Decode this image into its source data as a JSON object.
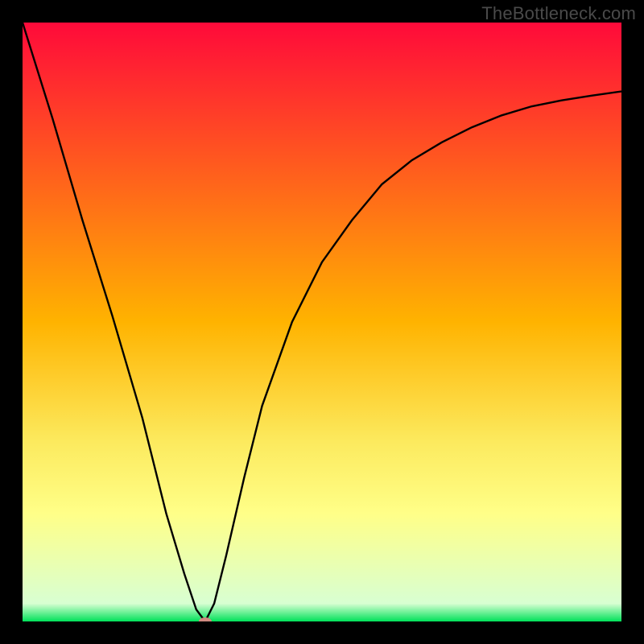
{
  "watermark": "TheBottleneck.com",
  "chart_data": {
    "type": "line",
    "title": "",
    "xlabel": "",
    "ylabel": "",
    "xlim": [
      0,
      100
    ],
    "ylim": [
      0,
      100
    ],
    "grid": false,
    "legend": false,
    "background_gradient": {
      "stops": [
        {
          "offset": 0.0,
          "color": "#ff0a3a"
        },
        {
          "offset": 0.5,
          "color": "#ffb300"
        },
        {
          "offset": 0.7,
          "color": "#fcea5e"
        },
        {
          "offset": 0.82,
          "color": "#ffff88"
        },
        {
          "offset": 0.97,
          "color": "#d8ffd2"
        },
        {
          "offset": 1.0,
          "color": "#00e15a"
        }
      ]
    },
    "series": [
      {
        "name": "bottleneck-curve",
        "x": [
          0,
          5,
          10,
          15,
          20,
          24,
          27,
          29,
          30.5,
          32,
          34,
          37,
          40,
          45,
          50,
          55,
          60,
          65,
          70,
          75,
          80,
          85,
          90,
          95,
          100
        ],
        "y": [
          100,
          84,
          67,
          51,
          34,
          18,
          8,
          2,
          0,
          3,
          11,
          24,
          36,
          50,
          60,
          67,
          73,
          77,
          80,
          82.5,
          84.5,
          86,
          87,
          87.8,
          88.5
        ]
      }
    ],
    "marker": {
      "x": 30.5,
      "y": 0,
      "color": "#d08a80",
      "rx": 8,
      "ry": 5
    },
    "axes_color": "#000000",
    "line_color": "#000000"
  }
}
